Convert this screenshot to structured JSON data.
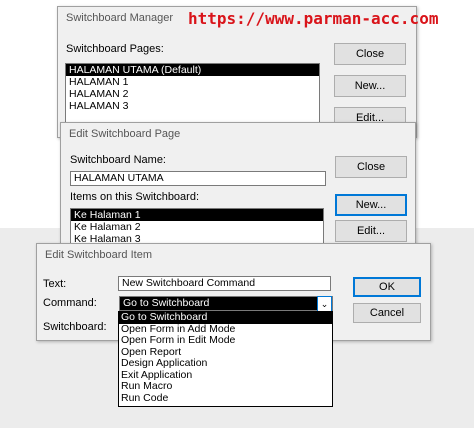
{
  "watermark": "https://www.parman-acc.com",
  "manager": {
    "title": "Switchboard Manager",
    "pages_label": "Switchboard Pages:",
    "pages": [
      "HALAMAN UTAMA (Default)",
      "HALAMAN 1",
      "HALAMAN 2",
      "HALAMAN 3"
    ],
    "close_label": "Close",
    "new_label": "New...",
    "edit_label": "Edit..."
  },
  "edit_page": {
    "title": "Edit Switchboard Page",
    "name_label": "Switchboard Name:",
    "name_value": "HALAMAN UTAMA",
    "items_label": "Items on this Switchboard:",
    "items": [
      "Ke Halaman 1",
      "Ke Halaman 2",
      "Ke Halaman 3"
    ],
    "close_label": "Close",
    "new_label": "New...",
    "edit_label": "Edit..."
  },
  "edit_item": {
    "title": "Edit Switchboard Item",
    "text_label": "Text:",
    "text_value": "New Switchboard Command",
    "command_label": "Command:",
    "command_value": "Go to Switchboard",
    "switchboard_label": "Switchboard:",
    "ok_label": "OK",
    "cancel_label": "Cancel",
    "command_options": [
      "Go to Switchboard",
      "Open Form in Add Mode",
      "Open Form in Edit Mode",
      "Open Report",
      "Design Application",
      "Exit Application",
      "Run Macro",
      "Run Code"
    ]
  }
}
